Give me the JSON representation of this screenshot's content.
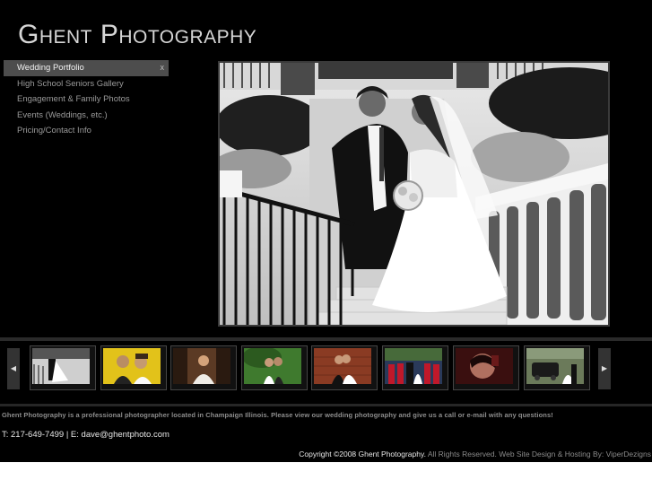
{
  "site": {
    "logo_text": "Ghent Photography"
  },
  "nav": {
    "items": [
      {
        "label": "Wedding Portfolio",
        "active": true,
        "close": "x"
      },
      {
        "label": "High School Seniors Gallery"
      },
      {
        "label": "Engagement & Family Photos"
      },
      {
        "label": "Events (Weddings, etc.)"
      },
      {
        "label": "Pricing/Contact Info"
      }
    ]
  },
  "filmstrip": {
    "prev_label": "◀",
    "next_label": "▶",
    "thumbnails": [
      {
        "icon": "photo-thumbnail",
        "palette": "bw"
      },
      {
        "icon": "photo-thumbnail",
        "palette": "yellow"
      },
      {
        "icon": "photo-thumbnail",
        "palette": "warm"
      },
      {
        "icon": "photo-thumbnail",
        "palette": "green"
      },
      {
        "icon": "photo-thumbnail",
        "palette": "brick"
      },
      {
        "icon": "photo-thumbnail",
        "palette": "red"
      },
      {
        "icon": "photo-thumbnail",
        "palette": "dark"
      },
      {
        "icon": "photo-thumbnail",
        "palette": "car"
      }
    ]
  },
  "footer": {
    "tagline": "Ghent Photography is a professional photographer located in Champaign Illinois. Please view our wedding photography and give us a call or e-mail with any questions!",
    "contact": "T: 217-649-7499 | E: dave@ghentphoto.com",
    "copyright_main": "Copyright ©2008 Ghent Photography.",
    "copyright_muted": " All Rights Reserved. Web Site Design & Hosting By: ViperDezigns"
  }
}
